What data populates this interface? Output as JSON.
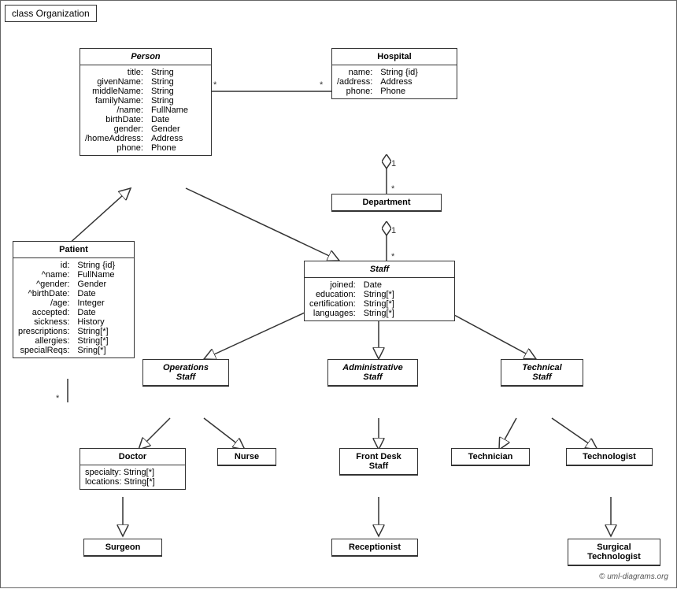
{
  "title": "class Organization",
  "copyright": "© uml-diagrams.org",
  "classes": {
    "person": {
      "name": "Person",
      "italic": true,
      "attrs": [
        {
          "name": "title:",
          "type": "String"
        },
        {
          "name": "givenName:",
          "type": "String"
        },
        {
          "name": "middleName:",
          "type": "String"
        },
        {
          "name": "familyName:",
          "type": "String"
        },
        {
          "name": "/name:",
          "type": "FullName"
        },
        {
          "name": "birthDate:",
          "type": "Date"
        },
        {
          "name": "gender:",
          "type": "Gender"
        },
        {
          "name": "/homeAddress:",
          "type": "Address"
        },
        {
          "name": "phone:",
          "type": "Phone"
        }
      ]
    },
    "hospital": {
      "name": "Hospital",
      "attrs": [
        {
          "name": "name:",
          "type": "String {id}"
        },
        {
          "name": "/address:",
          "type": "Address"
        },
        {
          "name": "phone:",
          "type": "Phone"
        }
      ]
    },
    "patient": {
      "name": "Patient",
      "attrs": [
        {
          "name": "id:",
          "type": "String {id}"
        },
        {
          "name": "^name:",
          "type": "FullName"
        },
        {
          "name": "^gender:",
          "type": "Gender"
        },
        {
          "name": "^birthDate:",
          "type": "Date"
        },
        {
          "name": "/age:",
          "type": "Integer"
        },
        {
          "name": "accepted:",
          "type": "Date"
        },
        {
          "name": "sickness:",
          "type": "History"
        },
        {
          "name": "prescriptions:",
          "type": "String[*]"
        },
        {
          "name": "allergies:",
          "type": "String[*]"
        },
        {
          "name": "specialReqs:",
          "type": "Sring[*]"
        }
      ]
    },
    "department": {
      "name": "Department"
    },
    "staff": {
      "name": "Staff",
      "italic": true,
      "attrs": [
        {
          "name": "joined:",
          "type": "Date"
        },
        {
          "name": "education:",
          "type": "String[*]"
        },
        {
          "name": "certification:",
          "type": "String[*]"
        },
        {
          "name": "languages:",
          "type": "String[*]"
        }
      ]
    },
    "operations_staff": {
      "name": "Operations Staff",
      "italic": true
    },
    "administrative_staff": {
      "name": "Administrative Staff",
      "italic": true
    },
    "technical_staff": {
      "name": "Technical Staff",
      "italic": true
    },
    "doctor": {
      "name": "Doctor",
      "attrs": [
        {
          "name": "specialty:",
          "type": "String[*]"
        },
        {
          "name": "locations:",
          "type": "String[*]"
        }
      ]
    },
    "nurse": {
      "name": "Nurse"
    },
    "front_desk_staff": {
      "name": "Front Desk Staff"
    },
    "technician": {
      "name": "Technician"
    },
    "technologist": {
      "name": "Technologist"
    },
    "surgeon": {
      "name": "Surgeon"
    },
    "receptionist": {
      "name": "Receptionist"
    },
    "surgical_technologist": {
      "name": "Surgical Technologist"
    }
  }
}
